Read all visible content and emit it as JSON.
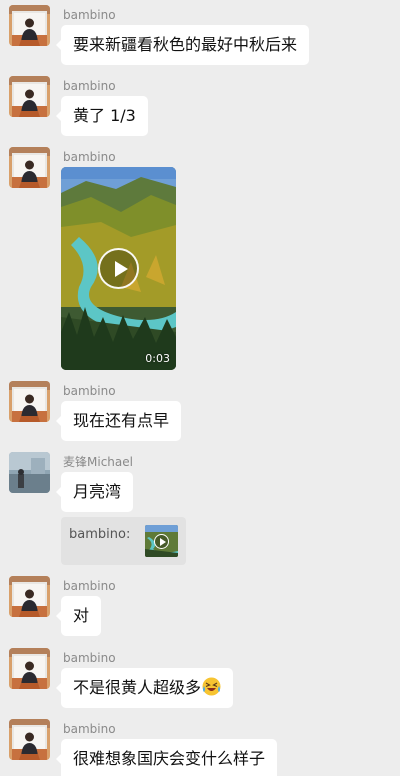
{
  "messages": [
    {
      "sender": "bambino",
      "text": "要来新疆看秋色的最好中秋后来"
    },
    {
      "sender": "bambino",
      "text": "黄了 1/3"
    },
    {
      "sender": "bambino",
      "video_duration": "0:03",
      "video_subject": "river valley in autumn forest"
    },
    {
      "sender": "bambino",
      "text": "现在还有点早"
    },
    {
      "sender": "麦锋Michael",
      "text": "月亮湾",
      "quote_sender": "bambino:"
    },
    {
      "sender": "bambino",
      "text": "对"
    },
    {
      "sender": "bambino",
      "text": "不是很黄人超级多",
      "emoji": "laughing-crying-emoji"
    },
    {
      "sender": "bambino",
      "text": "很难想象国庆会变什么样子"
    }
  ],
  "colors": {
    "background": "#ededed",
    "bubble": "#ffffff",
    "sender_name": "#8a8a8a",
    "quote_background": "#e2e2e2"
  }
}
